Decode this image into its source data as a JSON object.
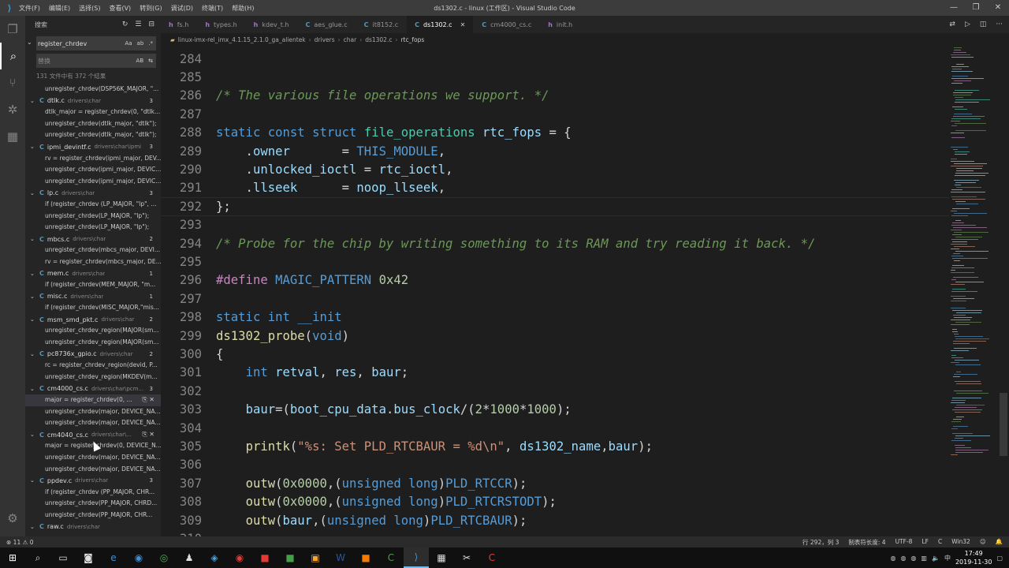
{
  "window": {
    "title": "ds1302.c - linux (工作区) - Visual Studio Code",
    "menu": [
      "文件(F)",
      "编辑(E)",
      "选择(S)",
      "查看(V)",
      "转到(G)",
      "调试(D)",
      "终端(T)",
      "帮助(H)"
    ],
    "controls": [
      "—",
      "❐",
      "✕"
    ]
  },
  "sidebar": {
    "title": "搜索",
    "search_value": "register_chrdev",
    "replace_placeholder": "替换",
    "search_opts": [
      "Aa",
      "ab",
      ".*"
    ],
    "replace_opt": "AB",
    "summary": "131 文件中有 372 个结果",
    "results": [
      {
        "kind": "match",
        "text": "unregister_chrdev(DSP56K_MAJOR, \"..."
      },
      {
        "kind": "file",
        "name": "dtlk.c",
        "path": "drivers\\char",
        "count": "3"
      },
      {
        "kind": "match",
        "text": "dtlk_major = register_chrdev(0, \"dtlk..."
      },
      {
        "kind": "match",
        "text": "unregister_chrdev(dtlk_major, \"dtlk\");"
      },
      {
        "kind": "match",
        "text": "unregister_chrdev(dtlk_major, \"dtlk\");"
      },
      {
        "kind": "file",
        "name": "ipmi_devintf.c",
        "path": "drivers\\char\\ipmi",
        "count": "3"
      },
      {
        "kind": "match",
        "text": "rv = register_chrdev(ipmi_major, DEV..."
      },
      {
        "kind": "match",
        "text": "unregister_chrdev(ipmi_major, DEVIC..."
      },
      {
        "kind": "match",
        "text": "unregister_chrdev(ipmi_major, DEVIC..."
      },
      {
        "kind": "file",
        "name": "lp.c",
        "path": "drivers\\char",
        "count": "3"
      },
      {
        "kind": "match",
        "text": "if (register_chrdev (LP_MAJOR, \"lp\", ..."
      },
      {
        "kind": "match",
        "text": "unregister_chrdev(LP_MAJOR, \"lp\");"
      },
      {
        "kind": "match",
        "text": "unregister_chrdev(LP_MAJOR, \"lp\");"
      },
      {
        "kind": "file",
        "name": "mbcs.c",
        "path": "drivers\\char",
        "count": "2"
      },
      {
        "kind": "match",
        "text": "unregister_chrdev(mbcs_major, DEVI..."
      },
      {
        "kind": "match",
        "text": "rv = register_chrdev(mbcs_major, DE..."
      },
      {
        "kind": "file",
        "name": "mem.c",
        "path": "drivers\\char",
        "count": "1"
      },
      {
        "kind": "match",
        "text": "if (register_chrdev(MEM_MAJOR, \"m..."
      },
      {
        "kind": "file",
        "name": "misc.c",
        "path": "drivers\\char",
        "count": "1"
      },
      {
        "kind": "match",
        "text": "if (register_chrdev(MISC_MAJOR,\"mis..."
      },
      {
        "kind": "file",
        "name": "msm_smd_pkt.c",
        "path": "drivers\\char",
        "count": "2"
      },
      {
        "kind": "match",
        "text": "unregister_chrdev_region(MAJOR(sm..."
      },
      {
        "kind": "match",
        "text": "unregister_chrdev_region(MAJOR(sm..."
      },
      {
        "kind": "file",
        "name": "pc8736x_gpio.c",
        "path": "drivers\\char",
        "count": "2"
      },
      {
        "kind": "match",
        "text": "rc = register_chrdev_region(devid, P..."
      },
      {
        "kind": "match",
        "text": "unregister_chrdev_region(MKDEV(m..."
      },
      {
        "kind": "file",
        "name": "cm4000_cs.c",
        "path": "drivers\\char\\pcm...",
        "count": "3"
      },
      {
        "kind": "match",
        "text": "major = register_chrdev(0, ...",
        "selected": true
      },
      {
        "kind": "match",
        "text": "unregister_chrdev(major, DEVICE_NA..."
      },
      {
        "kind": "match",
        "text": "unregister_chrdev(major, DEVICE_NA..."
      },
      {
        "kind": "file",
        "name": "cm4040_cs.c",
        "path": "drivers\\char\\...",
        "count": "",
        "hover": true
      },
      {
        "kind": "match",
        "text": "major = register_chrdev(0, DEVICE_N..."
      },
      {
        "kind": "match",
        "text": "unregister_chrdev(major, DEVICE_NA..."
      },
      {
        "kind": "match",
        "text": "unregister_chrdev(major, DEVICE_NA..."
      },
      {
        "kind": "file",
        "name": "ppdev.c",
        "path": "drivers\\char",
        "count": "3"
      },
      {
        "kind": "match",
        "text": "if (register_chrdev (PP_MAJOR, CHR..."
      },
      {
        "kind": "match",
        "text": "unregister_chrdev(PP_MAJOR, CHRD..."
      },
      {
        "kind": "match",
        "text": "unregister_chrdev(PP_MAJOR, CHR..."
      },
      {
        "kind": "file",
        "name": "raw.c",
        "path": "drivers\\char",
        "count": ""
      }
    ]
  },
  "tabs": [
    {
      "label": "fs.h",
      "icon": "h",
      "active": false
    },
    {
      "label": "types.h",
      "icon": "h",
      "active": false
    },
    {
      "label": "kdev_t.h",
      "icon": "h",
      "active": false
    },
    {
      "label": "aes_glue.c",
      "icon": "C",
      "active": false
    },
    {
      "label": "it8152.c",
      "icon": "C",
      "active": false
    },
    {
      "label": "ds1302.c",
      "icon": "C",
      "active": true
    },
    {
      "label": "cm4000_cs.c",
      "icon": "C",
      "active": false
    },
    {
      "label": "init.h",
      "icon": "h",
      "active": false
    }
  ],
  "breadcrumbs": [
    "linux-imx-rel_imx_4.1.15_2.1.0_ga_alientek",
    "drivers",
    "char",
    "ds1302.c",
    "rtc_fops"
  ],
  "editor": {
    "lines": [
      {
        "n": "284",
        "html": ""
      },
      {
        "n": "285",
        "html": ""
      },
      {
        "n": "286",
        "html": "<span class='cm'>/* The various file operations we support. */</span>"
      },
      {
        "n": "287",
        "html": ""
      },
      {
        "n": "288",
        "html": "<span class='kw'>static</span> <span class='kw'>const</span> <span class='kw'>struct</span> <span class='ty'>file_operations</span> <span class='var'>rtc_fops</span> = {"
      },
      {
        "n": "289",
        "html": "    .<span class='var'>owner</span>       = <span class='mac'>THIS_MODULE</span>,"
      },
      {
        "n": "290",
        "html": "    .<span class='var'>unlocked_ioctl</span> = <span class='var'>rtc_ioctl</span>,"
      },
      {
        "n": "291",
        "html": "    .<span class='var'>llseek</span>      = <span class='var'>noop_llseek</span>,"
      },
      {
        "n": "292",
        "html": "};",
        "hl": true
      },
      {
        "n": "293",
        "html": ""
      },
      {
        "n": "294",
        "html": "<span class='cm'>/* Probe for the chip by writing something to its RAM and try reading it back. */</span>"
      },
      {
        "n": "295",
        "html": ""
      },
      {
        "n": "296",
        "html": "<span class='pp'>#define</span> <span class='mac'>MAGIC_PATTERN</span> <span class='num'>0x42</span>"
      },
      {
        "n": "297",
        "html": ""
      },
      {
        "n": "298",
        "html": "<span class='kw'>static</span> <span class='kw'>int</span> <span class='kw'>__init</span>"
      },
      {
        "n": "299",
        "html": "<span class='fn'>ds1302_probe</span>(<span class='kw'>void</span>)"
      },
      {
        "n": "300",
        "html": "{"
      },
      {
        "n": "301",
        "html": "    <span class='kw'>int</span> <span class='var'>retval</span>, <span class='var'>res</span>, <span class='var'>baur</span>;"
      },
      {
        "n": "302",
        "html": ""
      },
      {
        "n": "303",
        "html": "    <span class='var'>baur</span>=(<span class='var'>boot_cpu_data</span>.<span class='var'>bus_clock</span>/(<span class='num'>2</span>*<span class='num'>1000</span>*<span class='num'>1000</span>);"
      },
      {
        "n": "304",
        "html": ""
      },
      {
        "n": "305",
        "html": "    <span class='fn'>printk</span>(<span class='str'>\"%s: Set PLD_RTCBAUR = %d\\n\"</span>, <span class='var'>ds1302_name</span>,<span class='var'>baur</span>);"
      },
      {
        "n": "306",
        "html": ""
      },
      {
        "n": "307",
        "html": "    <span class='fn'>outw</span>(<span class='num'>0x0000</span>,(<span class='kw'>unsigned</span> <span class='kw'>long</span>)<span class='mac'>PLD_RTCCR</span>);"
      },
      {
        "n": "308",
        "html": "    <span class='fn'>outw</span>(<span class='num'>0x0000</span>,(<span class='kw'>unsigned</span> <span class='kw'>long</span>)<span class='mac'>PLD_RTCRSTODT</span>);"
      },
      {
        "n": "309",
        "html": "    <span class='fn'>outw</span>(<span class='var'>baur</span>,(<span class='kw'>unsigned</span> <span class='kw'>long</span>)<span class='mac'>PLD_RTCBAUR</span>);"
      },
      {
        "n": "310",
        "html": ""
      }
    ]
  },
  "statusbar": {
    "left": "⊗ 11 ⚠ 0",
    "items": [
      "行 292，列 3",
      "制表符长度: 4",
      "UTF-8",
      "LF",
      "C",
      "Win32",
      "☺",
      "🔔"
    ]
  },
  "taskbar": {
    "time": "17:49",
    "date": "2019-11-30"
  }
}
